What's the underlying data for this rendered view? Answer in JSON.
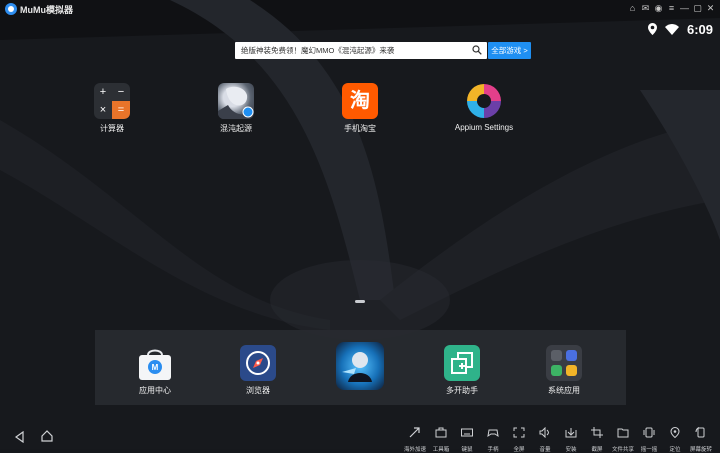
{
  "window": {
    "title": "MuMu模拟器"
  },
  "status_bar": {
    "time": "6:09"
  },
  "search": {
    "placeholder": "绝版神装免费领！魔幻MMO《混沌起源》来袭",
    "button_label": "全部游戏 >"
  },
  "desktop_apps": [
    {
      "label": "计算器",
      "icon": "calculator-icon"
    },
    {
      "label": "混沌起源",
      "icon": "game-chaos-origin-icon"
    },
    {
      "label": "手机淘宝",
      "icon": "taobao-icon"
    },
    {
      "label": "Appium Settings",
      "icon": "appium-icon"
    }
  ],
  "dock_apps": [
    {
      "label": "应用中心",
      "icon": "app-center-icon"
    },
    {
      "label": "浏览器",
      "icon": "browser-compass-icon"
    },
    {
      "label": "",
      "icon": "game-character-icon"
    },
    {
      "label": "多开助手",
      "icon": "multi-instance-icon"
    },
    {
      "label": "系统应用",
      "icon": "system-apps-folder-icon"
    }
  ],
  "toolbar": [
    {
      "label": "海外加速",
      "icon": "accelerate-icon"
    },
    {
      "label": "工具箱",
      "icon": "toolbox-icon"
    },
    {
      "label": "键鼠",
      "icon": "keyboard-icon"
    },
    {
      "label": "手柄",
      "icon": "gamepad-icon"
    },
    {
      "label": "全屏",
      "icon": "fullscreen-icon"
    },
    {
      "label": "音量",
      "icon": "volume-icon"
    },
    {
      "label": "安装",
      "icon": "install-apk-icon"
    },
    {
      "label": "截屏",
      "icon": "crop-icon"
    },
    {
      "label": "文件共享",
      "icon": "folder-icon"
    },
    {
      "label": "摇一摇",
      "icon": "shake-icon"
    },
    {
      "label": "定位",
      "icon": "location-icon"
    },
    {
      "label": "屏幕旋转",
      "icon": "rotate-icon"
    }
  ],
  "colors": {
    "accent": "#1f8ff2",
    "background": "#16181c",
    "dock": "#282a30"
  }
}
